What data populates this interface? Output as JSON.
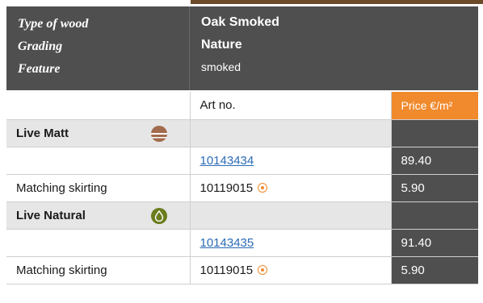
{
  "header": {
    "labels": [
      "Type of wood",
      "Grading",
      "Feature"
    ],
    "values": [
      "Oak Smoked",
      "Nature",
      "smoked"
    ]
  },
  "table": {
    "art_no_header": "Art no.",
    "price_header": "Price €/m²",
    "sections": [
      {
        "name": "Live Matt",
        "icon": "matt-finish-icon",
        "rows": [
          {
            "label": "",
            "art_no": "10143434",
            "art_link": true,
            "price": "89.40"
          },
          {
            "label": "Matching skirting",
            "art_no": "10119015",
            "art_link": false,
            "price": "5.90"
          }
        ]
      },
      {
        "name": "Live Natural",
        "icon": "natural-oil-drop-icon",
        "rows": [
          {
            "label": "",
            "art_no": "10143435",
            "art_link": true,
            "price": "91.40"
          },
          {
            "label": "Matching skirting",
            "art_no": "10119015",
            "art_link": false,
            "price": "5.90"
          }
        ]
      }
    ]
  },
  "colors": {
    "header_bg": "#4f4f4f",
    "accent": "#f08a2c",
    "link": "#2a6bb5",
    "natural_icon": "#6a7d1d",
    "matt_icon": "#a26b4d"
  }
}
